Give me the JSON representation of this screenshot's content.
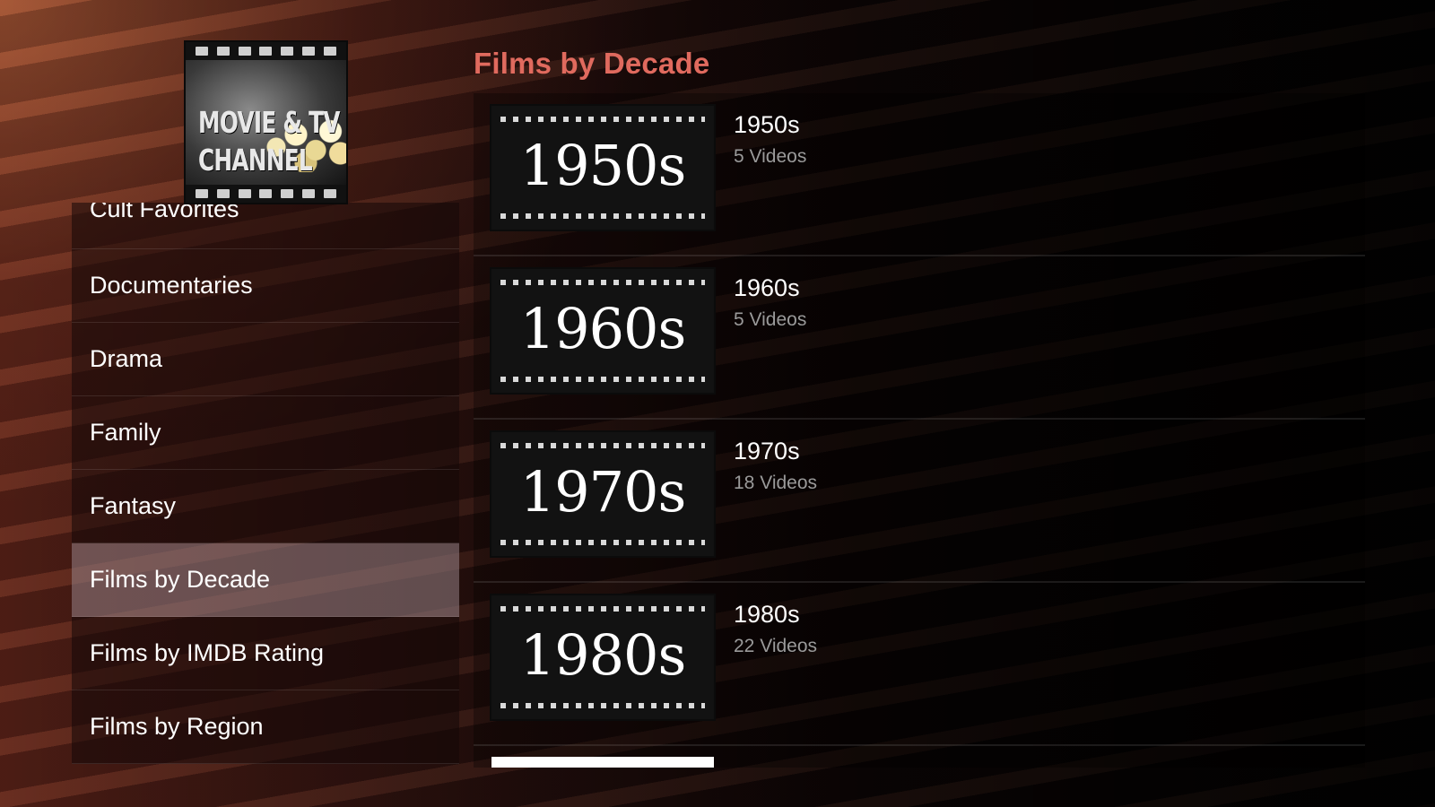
{
  "app": {
    "logo_line1": "MOVIE & TV",
    "logo_line2": "CHANNEL"
  },
  "sidebar": {
    "items": [
      {
        "label": "Cult Favorites"
      },
      {
        "label": "Documentaries"
      },
      {
        "label": "Drama"
      },
      {
        "label": "Family"
      },
      {
        "label": "Fantasy"
      },
      {
        "label": "Films by Decade",
        "active": true
      },
      {
        "label": "Films by IMDB Rating"
      },
      {
        "label": "Films by Region"
      }
    ]
  },
  "main": {
    "title": "Films by Decade",
    "rows": [
      {
        "thumb": "1950s",
        "title": "1950s",
        "count": "5 Videos"
      },
      {
        "thumb": "1960s",
        "title": "1960s",
        "count": "5 Videos"
      },
      {
        "thumb": "1970s",
        "title": "1970s",
        "count": "18 Videos"
      },
      {
        "thumb": "1980s",
        "title": "1980s",
        "count": "22 Videos"
      }
    ]
  },
  "colors": {
    "accent": "#e06a5e",
    "active_bg": "#968287",
    "muted_text": "#9a9a9a"
  }
}
